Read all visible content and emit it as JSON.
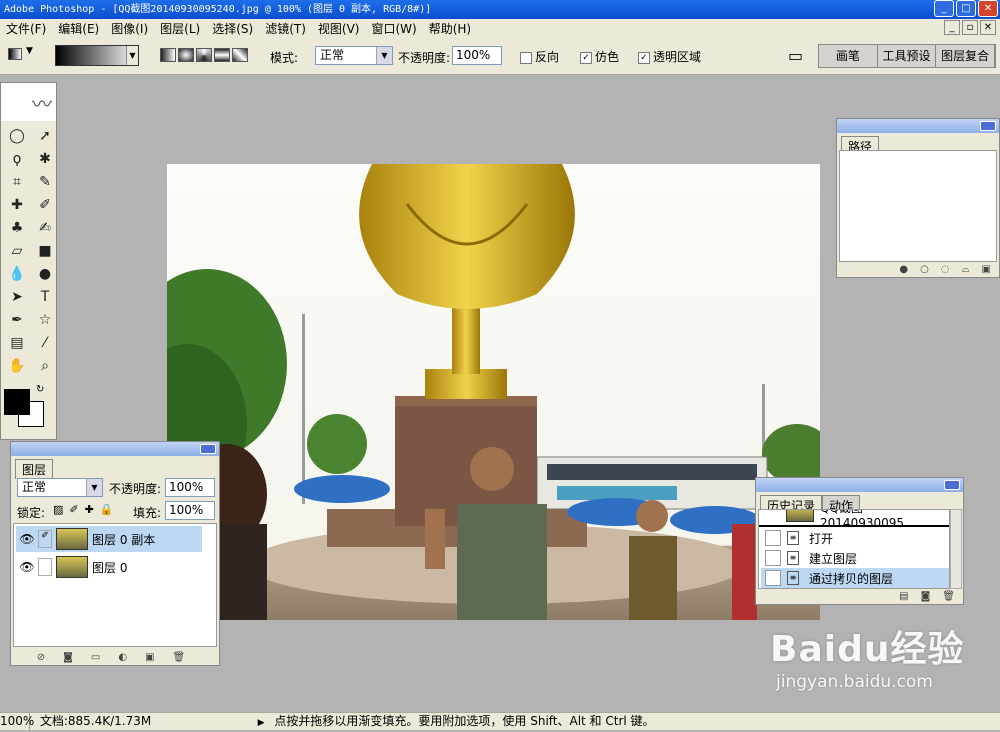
{
  "window": {
    "title": "Adobe Photoshop - [QQ截图20140930095240.jpg @ 100% (图层 0 副本, RGB/8#)]"
  },
  "menu": [
    "文件(F)",
    "编辑(E)",
    "图像(I)",
    "图层(L)",
    "选择(S)",
    "滤镜(T)",
    "视图(V)",
    "窗口(W)",
    "帮助(H)"
  ],
  "options": {
    "mode_label": "模式:",
    "mode_value": "正常",
    "opacity_label": "不透明度:",
    "opacity_value": "100%",
    "reverse_label": "反向",
    "dither_label": "仿色",
    "transparency_label": "透明区域",
    "reverse_checked": false,
    "dither_checked": true,
    "transparency_checked": true
  },
  "palette_well": [
    "画笔",
    "工具预设",
    "图层复合"
  ],
  "paths_panel": {
    "tab": "路径"
  },
  "layers_panel": {
    "tab": "图层",
    "blend_mode": "正常",
    "opacity_label": "不透明度:",
    "opacity_value": "100%",
    "lock_label": "锁定:",
    "fill_label": "填充:",
    "fill_value": "100%",
    "layers": [
      {
        "name": "图层 0 副本",
        "selected": true
      },
      {
        "name": "图层 0",
        "selected": false
      }
    ]
  },
  "history_panel": {
    "tabs": [
      "历史记录",
      "动作"
    ],
    "snapshot": "QQ截图20140930095...",
    "items": [
      "打开",
      "建立图层",
      "通过拷贝的图层"
    ]
  },
  "status": {
    "zoom": "100%",
    "doc": "文档:885.4K/1.73M",
    "hint": "点按并拖移以用渐变填充。要用附加选项，使用 Shift、Alt 和 Ctrl 键。"
  },
  "watermark": {
    "brand": "Baidu经验",
    "url": "jingyan.baidu.com"
  },
  "colors": {
    "titlebar": "#0a4ed0",
    "chrome": "#ece9d8",
    "workspace": "#b3b3b3",
    "selection": "#bcd8f2"
  }
}
